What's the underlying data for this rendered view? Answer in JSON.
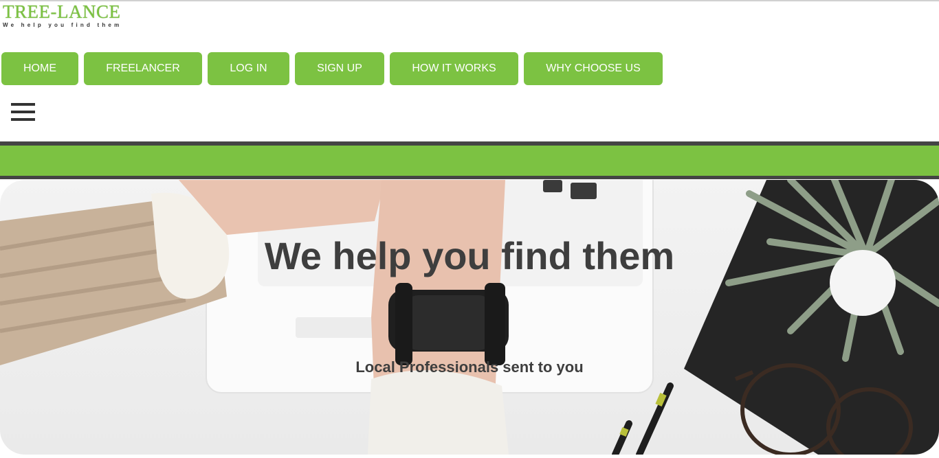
{
  "logo": {
    "title": "TREE-LANCE",
    "tagline": "We help you find them"
  },
  "nav": {
    "items": [
      {
        "label": "HOME"
      },
      {
        "label": "FREELANCER"
      },
      {
        "label": "LOG IN"
      },
      {
        "label": "SIGN UP"
      },
      {
        "label": "HOW IT WORKS"
      },
      {
        "label": "WHY CHOOSE US"
      }
    ]
  },
  "menu": {
    "icon": "hamburger-menu-icon"
  },
  "hero": {
    "title": "We help you find them",
    "subtitle": "Local Professionals sent to you"
  },
  "colors": {
    "accent": "#7cc242",
    "dark": "#444444",
    "text": "#3e3e3e"
  }
}
